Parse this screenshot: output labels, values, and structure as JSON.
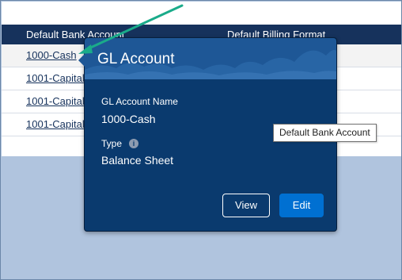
{
  "table": {
    "headers": {
      "bank_account": "Default Bank Account",
      "billing_format": "Default Billing Format"
    },
    "rows": [
      {
        "bank_account": "1000-Cash"
      },
      {
        "bank_account": "1001-Capital"
      },
      {
        "bank_account": "1001-Capital"
      },
      {
        "bank_account": "1001-Capital"
      }
    ]
  },
  "popover": {
    "title": "GL Account",
    "fields": [
      {
        "label": "GL Account Name",
        "value": "1000-Cash"
      },
      {
        "label": "Type",
        "value": "Balance Sheet"
      }
    ],
    "info_icon": "info-icon",
    "buttons": {
      "view": "View",
      "edit": "Edit"
    }
  },
  "tooltip": {
    "text": "Default Bank Account"
  },
  "colors": {
    "header_bg": "#16325c",
    "popover_bg": "#0a3a6e",
    "popover_header_bg": "#1e5796",
    "primary_button": "#0070d2",
    "annotation_arrow": "#1aab8a"
  }
}
